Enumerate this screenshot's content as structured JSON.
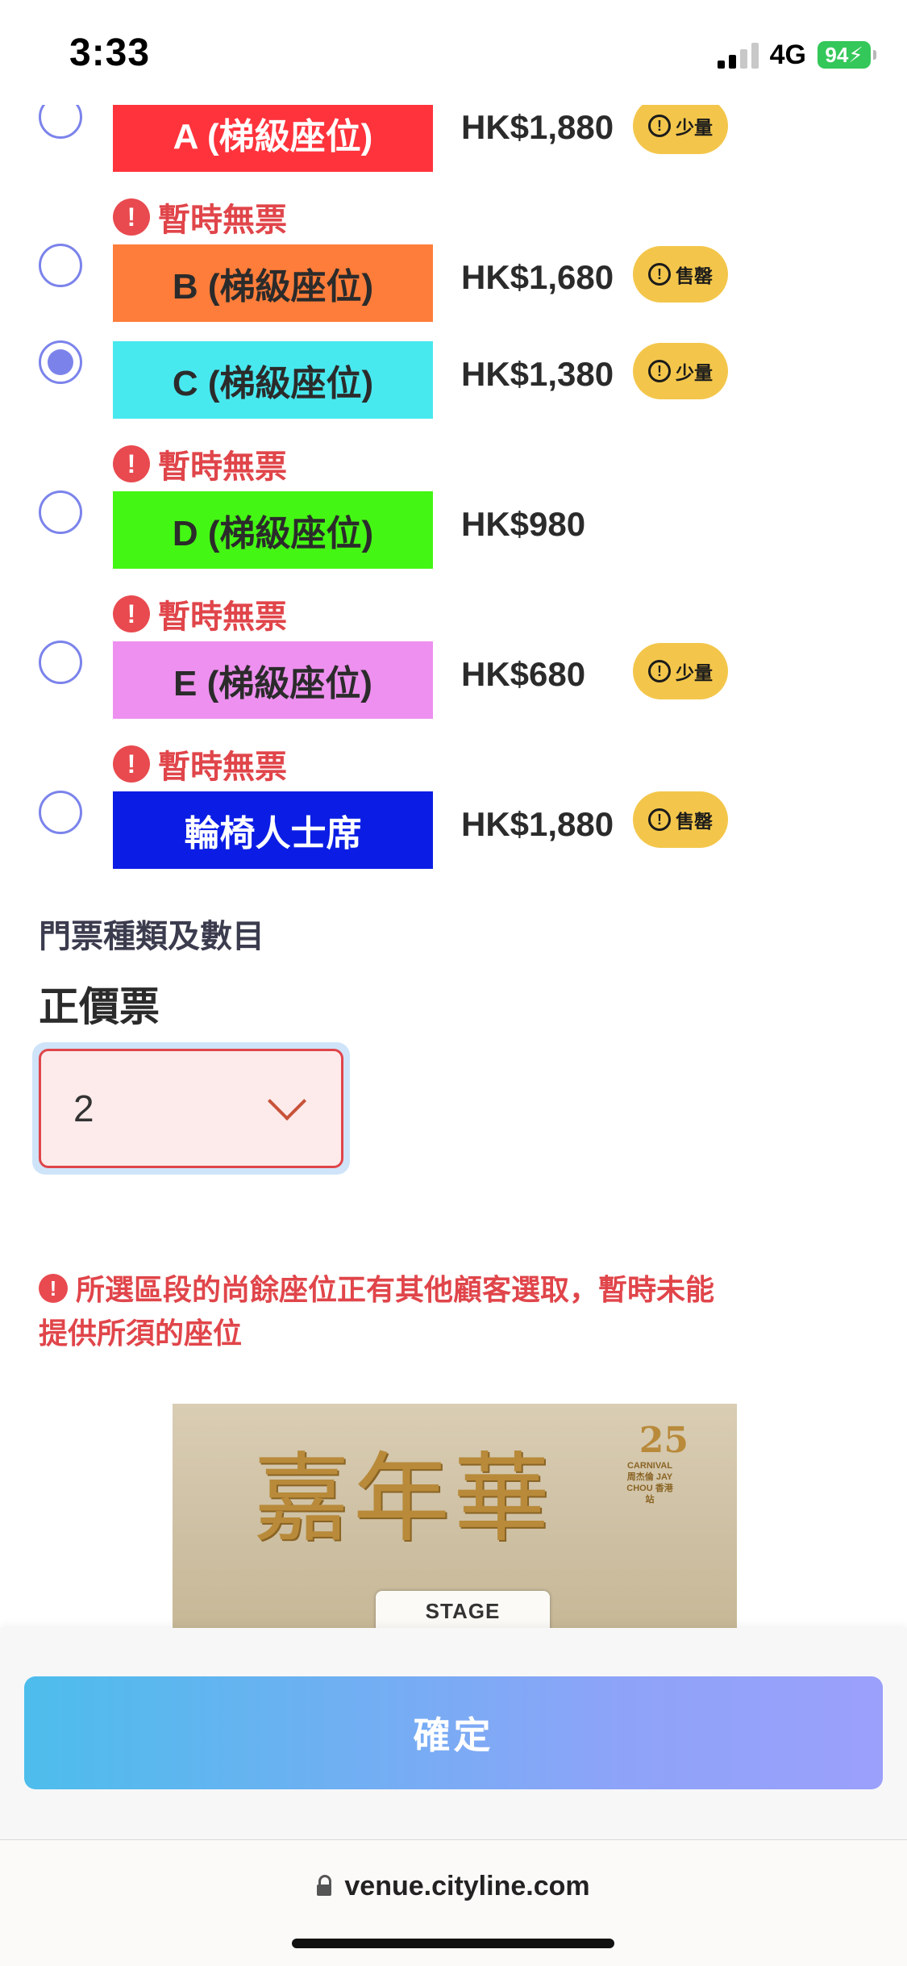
{
  "status": {
    "time": "3:33",
    "network": "4G",
    "battery": "94"
  },
  "sections": [
    {
      "label": "A (梯級座位)",
      "price": "HK$1,880",
      "badge": "少量",
      "color": "#ff333c",
      "text_color": "#ffffff",
      "checked": false,
      "warning": ""
    },
    {
      "label": "B (梯級座位)",
      "price": "HK$1,680",
      "badge": "售罄",
      "color": "#fe7d3a",
      "text_color": "#2b2b2b",
      "checked": false,
      "warning": "暫時無票"
    },
    {
      "label": "C (梯級座位)",
      "price": "HK$1,380",
      "badge": "少量",
      "color": "#48e8ef",
      "text_color": "#2b2b2b",
      "checked": true,
      "warning": ""
    },
    {
      "label": "D (梯級座位)",
      "price": "HK$980",
      "badge": "",
      "color": "#44f614",
      "text_color": "#2b2b2b",
      "checked": false,
      "warning": "暫時無票"
    },
    {
      "label": "E (梯級座位)",
      "price": "HK$680",
      "badge": "少量",
      "color": "#ee90ef",
      "text_color": "#2b2b2b",
      "checked": false,
      "warning": "暫時無票"
    },
    {
      "label": "輪椅人士席",
      "price": "HK$1,880",
      "badge": "售罄",
      "color": "#0b1de4",
      "text_color": "#ffffff",
      "checked": false,
      "warning": "暫時無票"
    }
  ],
  "ticket": {
    "type_heading": "門票種類及數目",
    "name": "正價票",
    "quantity": "2"
  },
  "error": {
    "line1": "所選區段的尚餘座位正有其他顧客選取，暫時未能",
    "line2": "提供所須的座位"
  },
  "seat_map": {
    "title": "嘉年華",
    "badge_number": "25",
    "subtitle": "CARNIVAL 周杰倫 JAY CHOU 香港站",
    "stage_label": "STAGE"
  },
  "confirm_label": "確定",
  "browser": {
    "url": "venue.cityline.com"
  }
}
